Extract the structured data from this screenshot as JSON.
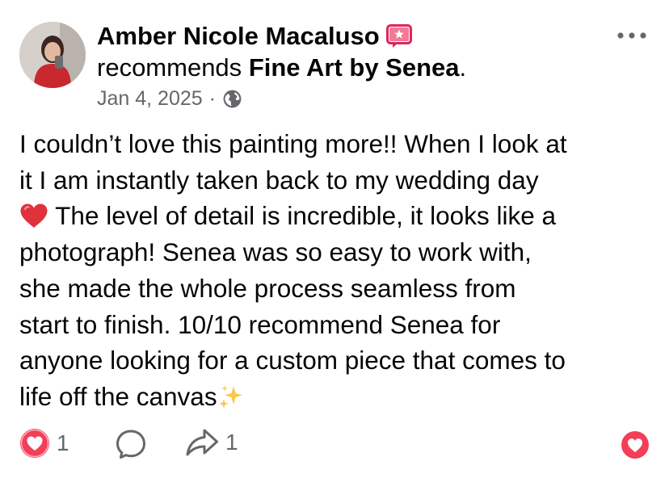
{
  "post": {
    "author": "Amber Nicole Macaluso",
    "recommends_word": "recommends",
    "page_name": "Fine Art by Senea",
    "period": ".",
    "date": "Jan 4, 2025",
    "separator": "·",
    "body_lines": [
      "I couldn’t love this painting more!! When I look at",
      "it I am instantly taken back to my wedding day",
      " The level of detail is incredible, it looks like a",
      "photograph! Senea was so easy to work with,",
      "she made the whole process seamless from",
      "start to finish. 10/10 recommend Senea for",
      "anyone looking for a custom piece that comes to",
      "life off the canvas"
    ],
    "reactions_count": "1",
    "shares_count": "1"
  },
  "icons": {
    "more": "more-horizontal-icon",
    "globe": "globe-icon",
    "badge": "recommendation-badge-icon",
    "heart_emoji": "red-heart-emoji",
    "sparkles_emoji": "sparkles-emoji",
    "love_reaction": "love-reaction-icon",
    "comment": "comment-icon",
    "share": "share-icon",
    "react_button": "love-react-button-icon"
  },
  "colors": {
    "text": "#050505",
    "muted": "#65676b",
    "badge": "#e0245e",
    "love": "#f33e58"
  }
}
